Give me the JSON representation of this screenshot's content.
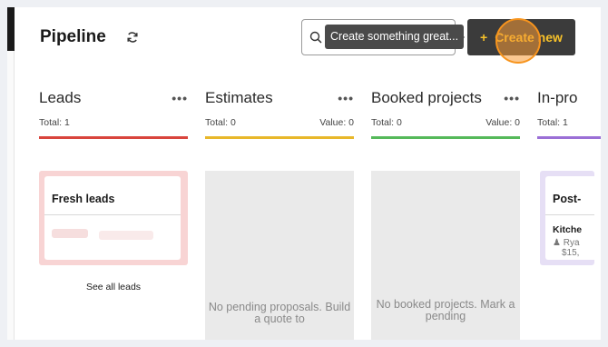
{
  "header": {
    "title": "Pipeline",
    "search_tooltip": "Create something great...",
    "create_button": "Create new",
    "create_plus": "+"
  },
  "columns": [
    {
      "title": "Leads",
      "total": "Total: 1",
      "value": "",
      "color": "#d9453d",
      "empty_text": ""
    },
    {
      "title": "Estimates",
      "total": "Total: 0",
      "value": "Value: 0",
      "color": "#e8b72a",
      "empty_text": "No pending proposals. Build a quote to"
    },
    {
      "title": "Booked projects",
      "total": "Total: 0",
      "value": "Value: 0",
      "color": "#55b95a",
      "empty_text": "No booked projects. Mark a pending"
    },
    {
      "title": "In-pro",
      "total": "Total: 1",
      "value": "",
      "color": "#9b6fd6",
      "empty_text": ""
    }
  ],
  "lead_card": {
    "title": "Fresh leads",
    "see_all": "See all leads"
  },
  "inprogress_card": {
    "title": "Post-",
    "subtitle": "Kitche",
    "meta1": "Rya",
    "meta2": "$15,"
  }
}
